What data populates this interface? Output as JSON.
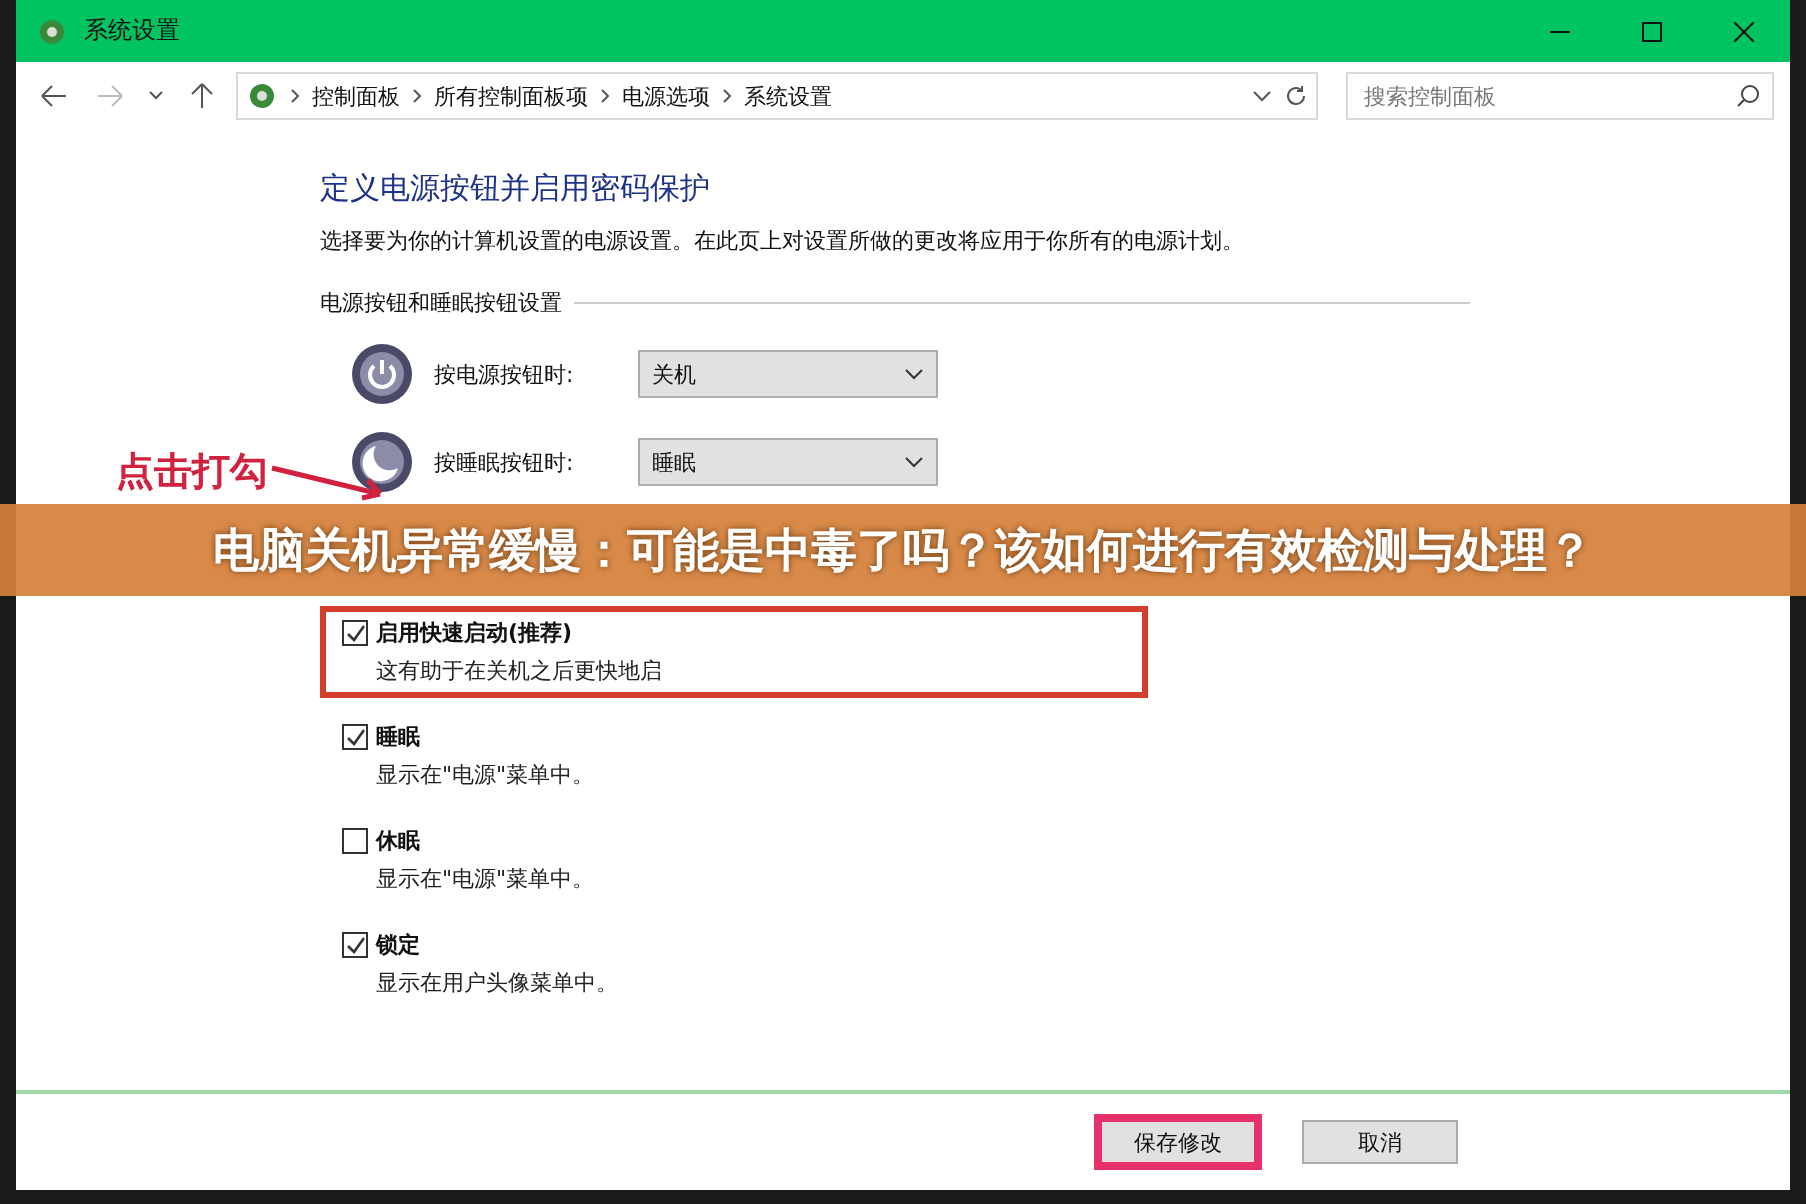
{
  "window": {
    "title": "系统设置"
  },
  "address_bar": {
    "breadcrumbs": [
      "控制面板",
      "所有控制面板项",
      "电源选项",
      "系统设置"
    ],
    "search": {
      "placeholder": "搜索控制面板"
    }
  },
  "page": {
    "heading": "定义电源按钮并启用密码保护",
    "description": "选择要为你的计算机设置的电源设置。在此页上对设置所做的更改将应用于你所有的电源计划。",
    "section": "电源按钮和睡眠按钮设置",
    "button_settings": [
      {
        "kind": "power",
        "label": "按电源按钮时:",
        "value": "关机"
      },
      {
        "kind": "sleep",
        "label": "按睡眠按钮时:",
        "value": "睡眠"
      }
    ],
    "options": [
      {
        "label": "启用快速启动(推荐)",
        "hint": "这有助于在关机之后更快地启",
        "checked": true,
        "highlighted": true
      },
      {
        "label": "睡眠",
        "hint": "显示在\"电源\"菜单中。",
        "checked": true,
        "highlighted": false
      },
      {
        "label": "休眠",
        "hint": "显示在\"电源\"菜单中。",
        "checked": false,
        "highlighted": false
      },
      {
        "label": "锁定",
        "hint": "显示在用户头像菜单中。",
        "checked": true,
        "highlighted": false
      }
    ]
  },
  "annotation": {
    "text": "点击打勾"
  },
  "banner": {
    "title": "电脑关机异常缓慢：可能是中毒了吗？该如何进行有效检测与处理？"
  },
  "buttons": [
    {
      "label": "保存修改",
      "highlighted": true
    },
    {
      "label": "取消",
      "highlighted": false
    }
  ]
}
